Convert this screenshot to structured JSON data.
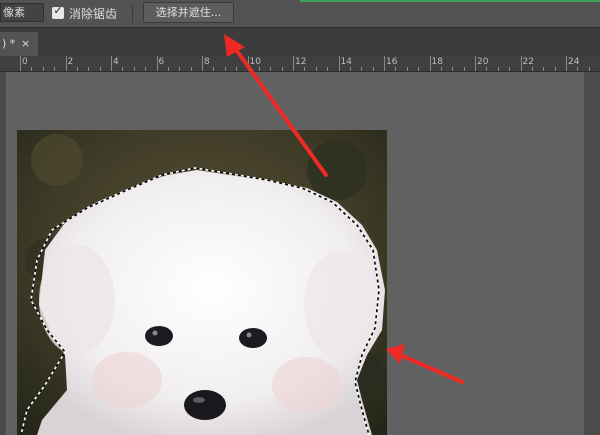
{
  "options_bar": {
    "feather_value": "像素",
    "antialias_checked": true,
    "antialias_label": "消除锯齿",
    "refine_button_label": "选择并遮住..."
  },
  "document_tab": {
    "title": ") *",
    "close_glyph": "×"
  },
  "ruler": {
    "labels": [
      "0",
      "2",
      "4",
      "6",
      "8",
      "10",
      "12",
      "14",
      "16",
      "18",
      "20",
      "22",
      "24"
    ]
  },
  "colors": {
    "accent_green": "#3aa55a",
    "annotation_arrow": "#ee2a24",
    "canvas_background": "#616161"
  }
}
